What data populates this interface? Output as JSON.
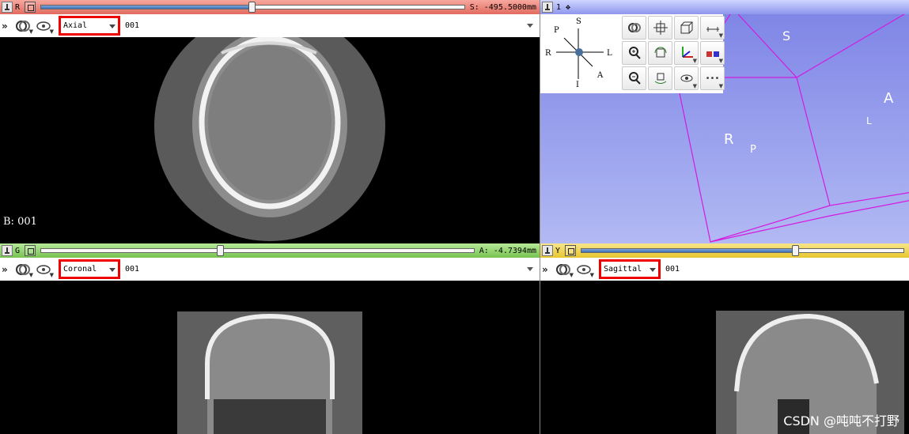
{
  "views": {
    "red": {
      "letter": "R",
      "color": "#f28a7f",
      "offset": "S: -495.5000mm",
      "orientation": "Axial",
      "volume": "001",
      "overlay": "B: 001"
    },
    "green": {
      "letter": "G",
      "color": "#8fd26d",
      "offset": "A: -4.7394mm",
      "orientation": "Coronal",
      "volume": "001"
    },
    "yellow": {
      "letter": "Y",
      "color": "#f3d64a",
      "orientation": "Sagittal",
      "volume": "001"
    },
    "threed": {
      "index": "1",
      "labels": {
        "s": "S",
        "a": "A",
        "l": "L",
        "r": "R",
        "p": "P"
      },
      "orientation_marker": {
        "s": "S",
        "p": "P",
        "r": "R",
        "l": "L",
        "a": "A",
        "i": "I"
      }
    }
  },
  "toolbar_icons": [
    "link-icon",
    "eye-toggle-icon",
    "dropdown-icon"
  ],
  "tools_3d": [
    "center-view-icon",
    "pin-icon",
    "cube-icon",
    "ruler-icon",
    "zoom-in-icon",
    "rotate-icon",
    "axes-icon",
    "stereo-icon",
    "zoom-out-icon",
    "reset-icon",
    "visibility-icon",
    "more-icon"
  ],
  "watermark": "CSDN @吨吨不打野",
  "colors": {
    "highlight_border": "#e00000",
    "bg3d": "#8d93ea",
    "wire": "#d41ae0"
  }
}
